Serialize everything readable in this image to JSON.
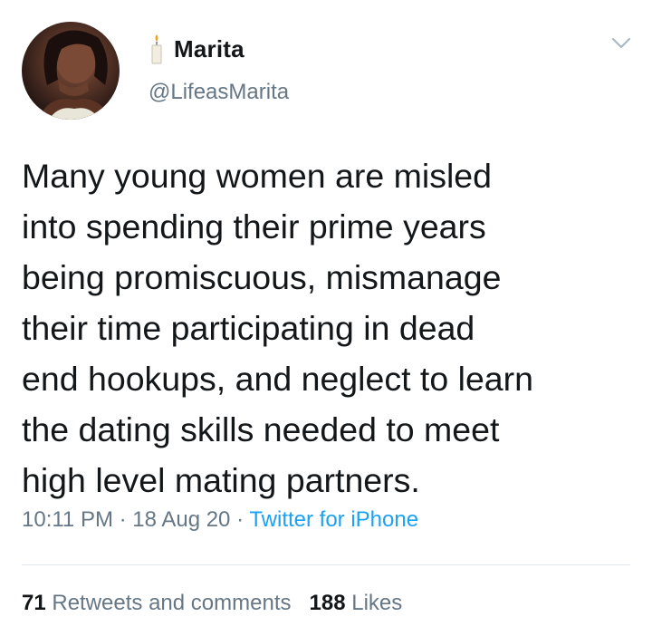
{
  "author": {
    "display_name": "Marita",
    "handle": "@LifeasMarita",
    "name_prefix_icon": "candle-icon",
    "avatar": "profile-photo"
  },
  "menu": {
    "icon": "chevron-down-icon"
  },
  "tweet": {
    "lines": [
      "Many young women are misled",
      "into spending their prime years",
      "being promiscuous, mismanage",
      "their time participating in dead",
      "end hookups, and neglect to learn",
      "the dating skills needed to meet",
      "high level mating partners."
    ],
    "time": "10:11 PM",
    "date": "18 Aug 20",
    "separator": "·",
    "source": "Twitter for iPhone"
  },
  "stats": {
    "retweets_count": "71",
    "retweets_label": "Retweets and comments",
    "likes_count": "188",
    "likes_label": "Likes"
  },
  "colors": {
    "text": "#14171a",
    "secondary": "#657786",
    "link": "#1da1f2",
    "divider": "#e1e8ed"
  }
}
